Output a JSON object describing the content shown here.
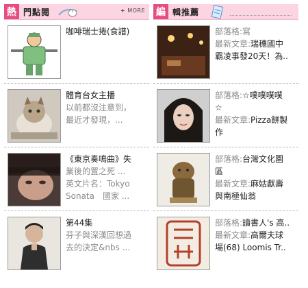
{
  "left_panel": {
    "badge": "熱",
    "title": "門點閱",
    "more_plus": "+",
    "more_label": "MORE",
    "items": [
      {
        "title": "咖啡瑞士捲(食譜)",
        "lines": []
      },
      {
        "title": "體育台女主播",
        "lines": [
          "以前都沒注意到，",
          "最近才發現，..."
        ]
      },
      {
        "title": "《東京奏鳴曲》失",
        "lines": [
          "業後的置之死 ...",
          "英文片名：Tokyo",
          "Sonata　國家 ..."
        ]
      },
      {
        "title": "第44集",
        "lines": [
          "芬子與深漢回想過",
          "去的決定&nbs ..."
        ]
      }
    ]
  },
  "right_panel": {
    "badge": "編",
    "title": "輯推薦",
    "items": [
      {
        "line1_label": "部落格:",
        "line1_value": "寫",
        "line2_label": "最新文章:",
        "line2_value": "瑞穗國中",
        "line3": "霸凌事發20天！為.."
      },
      {
        "line1_label": "部落格:",
        "line1_value": "☆噗噗噗噗",
        "line1b": "☆",
        "line2_label": "最新文章:",
        "line2_value": "Pizza餅製",
        "line3": "作"
      },
      {
        "line1_label": "部落格:",
        "line1_value": "台灣文化園",
        "line1b": "區",
        "line2_label": "最新文章:",
        "line2_value": "麻姑獻壽",
        "line3": "與南極仙翁"
      },
      {
        "line1_label": "部落格:",
        "line1_value": "讀書人's 高..",
        "line2_label": "最新文章:",
        "line2_value": "高爾夫球",
        "line3": "場(68) Loomis Tr.."
      }
    ]
  }
}
